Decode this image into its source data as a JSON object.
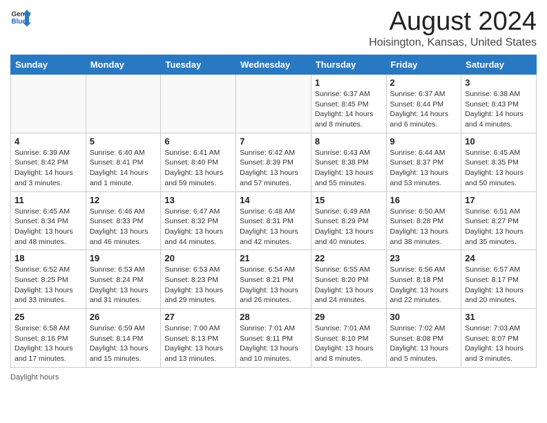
{
  "header": {
    "logo_line1": "General",
    "logo_line2": "Blue",
    "month_title": "August 2024",
    "location": "Hoisington, Kansas, United States"
  },
  "weekdays": [
    "Sunday",
    "Monday",
    "Tuesday",
    "Wednesday",
    "Thursday",
    "Friday",
    "Saturday"
  ],
  "weeks": [
    [
      {
        "day": "",
        "info": ""
      },
      {
        "day": "",
        "info": ""
      },
      {
        "day": "",
        "info": ""
      },
      {
        "day": "",
        "info": ""
      },
      {
        "day": "1",
        "info": "Sunrise: 6:37 AM\nSunset: 8:45 PM\nDaylight: 14 hours and 8 minutes."
      },
      {
        "day": "2",
        "info": "Sunrise: 6:37 AM\nSunset: 8:44 PM\nDaylight: 14 hours and 6 minutes."
      },
      {
        "day": "3",
        "info": "Sunrise: 6:38 AM\nSunset: 8:43 PM\nDaylight: 14 hours and 4 minutes."
      }
    ],
    [
      {
        "day": "4",
        "info": "Sunrise: 6:39 AM\nSunset: 8:42 PM\nDaylight: 14 hours and 3 minutes."
      },
      {
        "day": "5",
        "info": "Sunrise: 6:40 AM\nSunset: 8:41 PM\nDaylight: 14 hours and 1 minute."
      },
      {
        "day": "6",
        "info": "Sunrise: 6:41 AM\nSunset: 8:40 PM\nDaylight: 13 hours and 59 minutes."
      },
      {
        "day": "7",
        "info": "Sunrise: 6:42 AM\nSunset: 8:39 PM\nDaylight: 13 hours and 57 minutes."
      },
      {
        "day": "8",
        "info": "Sunrise: 6:43 AM\nSunset: 8:38 PM\nDaylight: 13 hours and 55 minutes."
      },
      {
        "day": "9",
        "info": "Sunrise: 6:44 AM\nSunset: 8:37 PM\nDaylight: 13 hours and 53 minutes."
      },
      {
        "day": "10",
        "info": "Sunrise: 6:45 AM\nSunset: 8:35 PM\nDaylight: 13 hours and 50 minutes."
      }
    ],
    [
      {
        "day": "11",
        "info": "Sunrise: 6:45 AM\nSunset: 8:34 PM\nDaylight: 13 hours and 48 minutes."
      },
      {
        "day": "12",
        "info": "Sunrise: 6:46 AM\nSunset: 8:33 PM\nDaylight: 13 hours and 46 minutes."
      },
      {
        "day": "13",
        "info": "Sunrise: 6:47 AM\nSunset: 8:32 PM\nDaylight: 13 hours and 44 minutes."
      },
      {
        "day": "14",
        "info": "Sunrise: 6:48 AM\nSunset: 8:31 PM\nDaylight: 13 hours and 42 minutes."
      },
      {
        "day": "15",
        "info": "Sunrise: 6:49 AM\nSunset: 8:29 PM\nDaylight: 13 hours and 40 minutes."
      },
      {
        "day": "16",
        "info": "Sunrise: 6:50 AM\nSunset: 8:28 PM\nDaylight: 13 hours and 38 minutes."
      },
      {
        "day": "17",
        "info": "Sunrise: 6:51 AM\nSunset: 8:27 PM\nDaylight: 13 hours and 35 minutes."
      }
    ],
    [
      {
        "day": "18",
        "info": "Sunrise: 6:52 AM\nSunset: 8:25 PM\nDaylight: 13 hours and 33 minutes."
      },
      {
        "day": "19",
        "info": "Sunrise: 6:53 AM\nSunset: 8:24 PM\nDaylight: 13 hours and 31 minutes."
      },
      {
        "day": "20",
        "info": "Sunrise: 6:53 AM\nSunset: 8:23 PM\nDaylight: 13 hours and 29 minutes."
      },
      {
        "day": "21",
        "info": "Sunrise: 6:54 AM\nSunset: 8:21 PM\nDaylight: 13 hours and 26 minutes."
      },
      {
        "day": "22",
        "info": "Sunrise: 6:55 AM\nSunset: 8:20 PM\nDaylight: 13 hours and 24 minutes."
      },
      {
        "day": "23",
        "info": "Sunrise: 6:56 AM\nSunset: 8:18 PM\nDaylight: 13 hours and 22 minutes."
      },
      {
        "day": "24",
        "info": "Sunrise: 6:57 AM\nSunset: 8:17 PM\nDaylight: 13 hours and 20 minutes."
      }
    ],
    [
      {
        "day": "25",
        "info": "Sunrise: 6:58 AM\nSunset: 8:16 PM\nDaylight: 13 hours and 17 minutes."
      },
      {
        "day": "26",
        "info": "Sunrise: 6:59 AM\nSunset: 8:14 PM\nDaylight: 13 hours and 15 minutes."
      },
      {
        "day": "27",
        "info": "Sunrise: 7:00 AM\nSunset: 8:13 PM\nDaylight: 13 hours and 13 minutes."
      },
      {
        "day": "28",
        "info": "Sunrise: 7:01 AM\nSunset: 8:11 PM\nDaylight: 13 hours and 10 minutes."
      },
      {
        "day": "29",
        "info": "Sunrise: 7:01 AM\nSunset: 8:10 PM\nDaylight: 13 hours and 8 minutes."
      },
      {
        "day": "30",
        "info": "Sunrise: 7:02 AM\nSunset: 8:08 PM\nDaylight: 13 hours and 5 minutes."
      },
      {
        "day": "31",
        "info": "Sunrise: 7:03 AM\nSunset: 8:07 PM\nDaylight: 13 hours and 3 minutes."
      }
    ]
  ],
  "footer": {
    "daylight_label": "Daylight hours"
  }
}
